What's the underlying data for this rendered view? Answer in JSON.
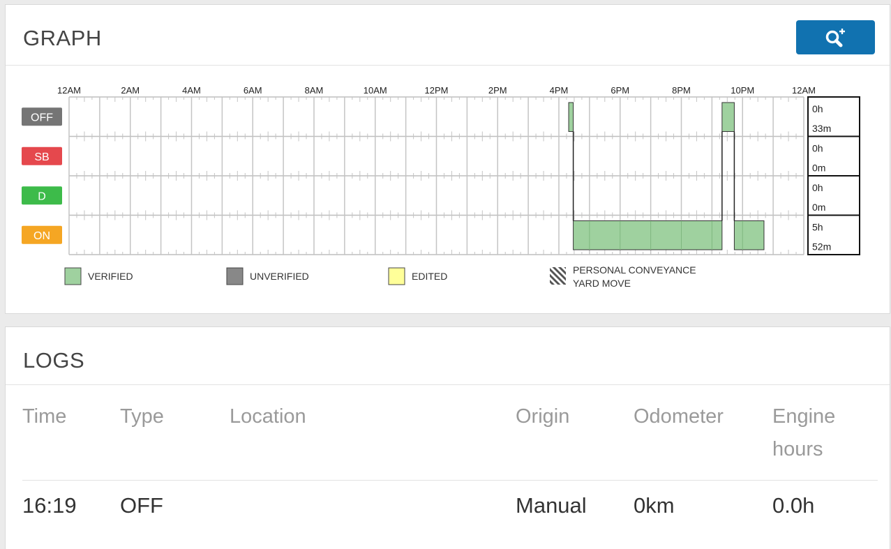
{
  "graph": {
    "title": "GRAPH",
    "zoom_icon": "zoom-in-icon",
    "time_labels": [
      "12AM",
      "2AM",
      "4AM",
      "6AM",
      "8AM",
      "10AM",
      "12PM",
      "2PM",
      "4PM",
      "6PM",
      "8PM",
      "10PM",
      "12AM"
    ],
    "statuses": [
      {
        "label": "OFF",
        "color": "#757575",
        "total_h": "0h",
        "total_m": "33m"
      },
      {
        "label": "SB",
        "color": "#e5484d",
        "total_h": "0h",
        "total_m": "0m"
      },
      {
        "label": "D",
        "color": "#3dbb4a",
        "total_h": "0h",
        "total_m": "0m"
      },
      {
        "label": "ON",
        "color": "#f5a623",
        "total_h": "5h",
        "total_m": "52m"
      }
    ],
    "legend": [
      {
        "label": "VERIFIED",
        "color": "#9fd19f"
      },
      {
        "label": "UNVERIFIED",
        "color": "#888888"
      },
      {
        "label": "EDITED",
        "color": "#ffff99"
      },
      {
        "label": "PERSONAL CONVEYANCE",
        "label2": "YARD MOVE",
        "pattern": "striped"
      }
    ]
  },
  "chart_data": {
    "type": "duty-status-timeline",
    "x_unit": "hour of day",
    "xlim": [
      0,
      24
    ],
    "rows": [
      "OFF",
      "SB",
      "D",
      "ON"
    ],
    "segments": [
      {
        "status": "OFF",
        "start": 16.32,
        "end": 16.47,
        "state": "verified"
      },
      {
        "status": "ON",
        "start": 16.47,
        "end": 21.33,
        "state": "verified"
      },
      {
        "status": "OFF",
        "start": 21.33,
        "end": 21.73,
        "state": "verified"
      },
      {
        "status": "ON",
        "start": 21.73,
        "end": 22.7,
        "state": "verified"
      }
    ]
  },
  "logs": {
    "title": "LOGS",
    "columns": [
      "Time",
      "Type",
      "Location",
      "Origin",
      "Odometer",
      "Engine hours"
    ],
    "rows": [
      [
        "16:19",
        "OFF",
        "",
        "Manual",
        "0km",
        "0.0h"
      ]
    ]
  }
}
